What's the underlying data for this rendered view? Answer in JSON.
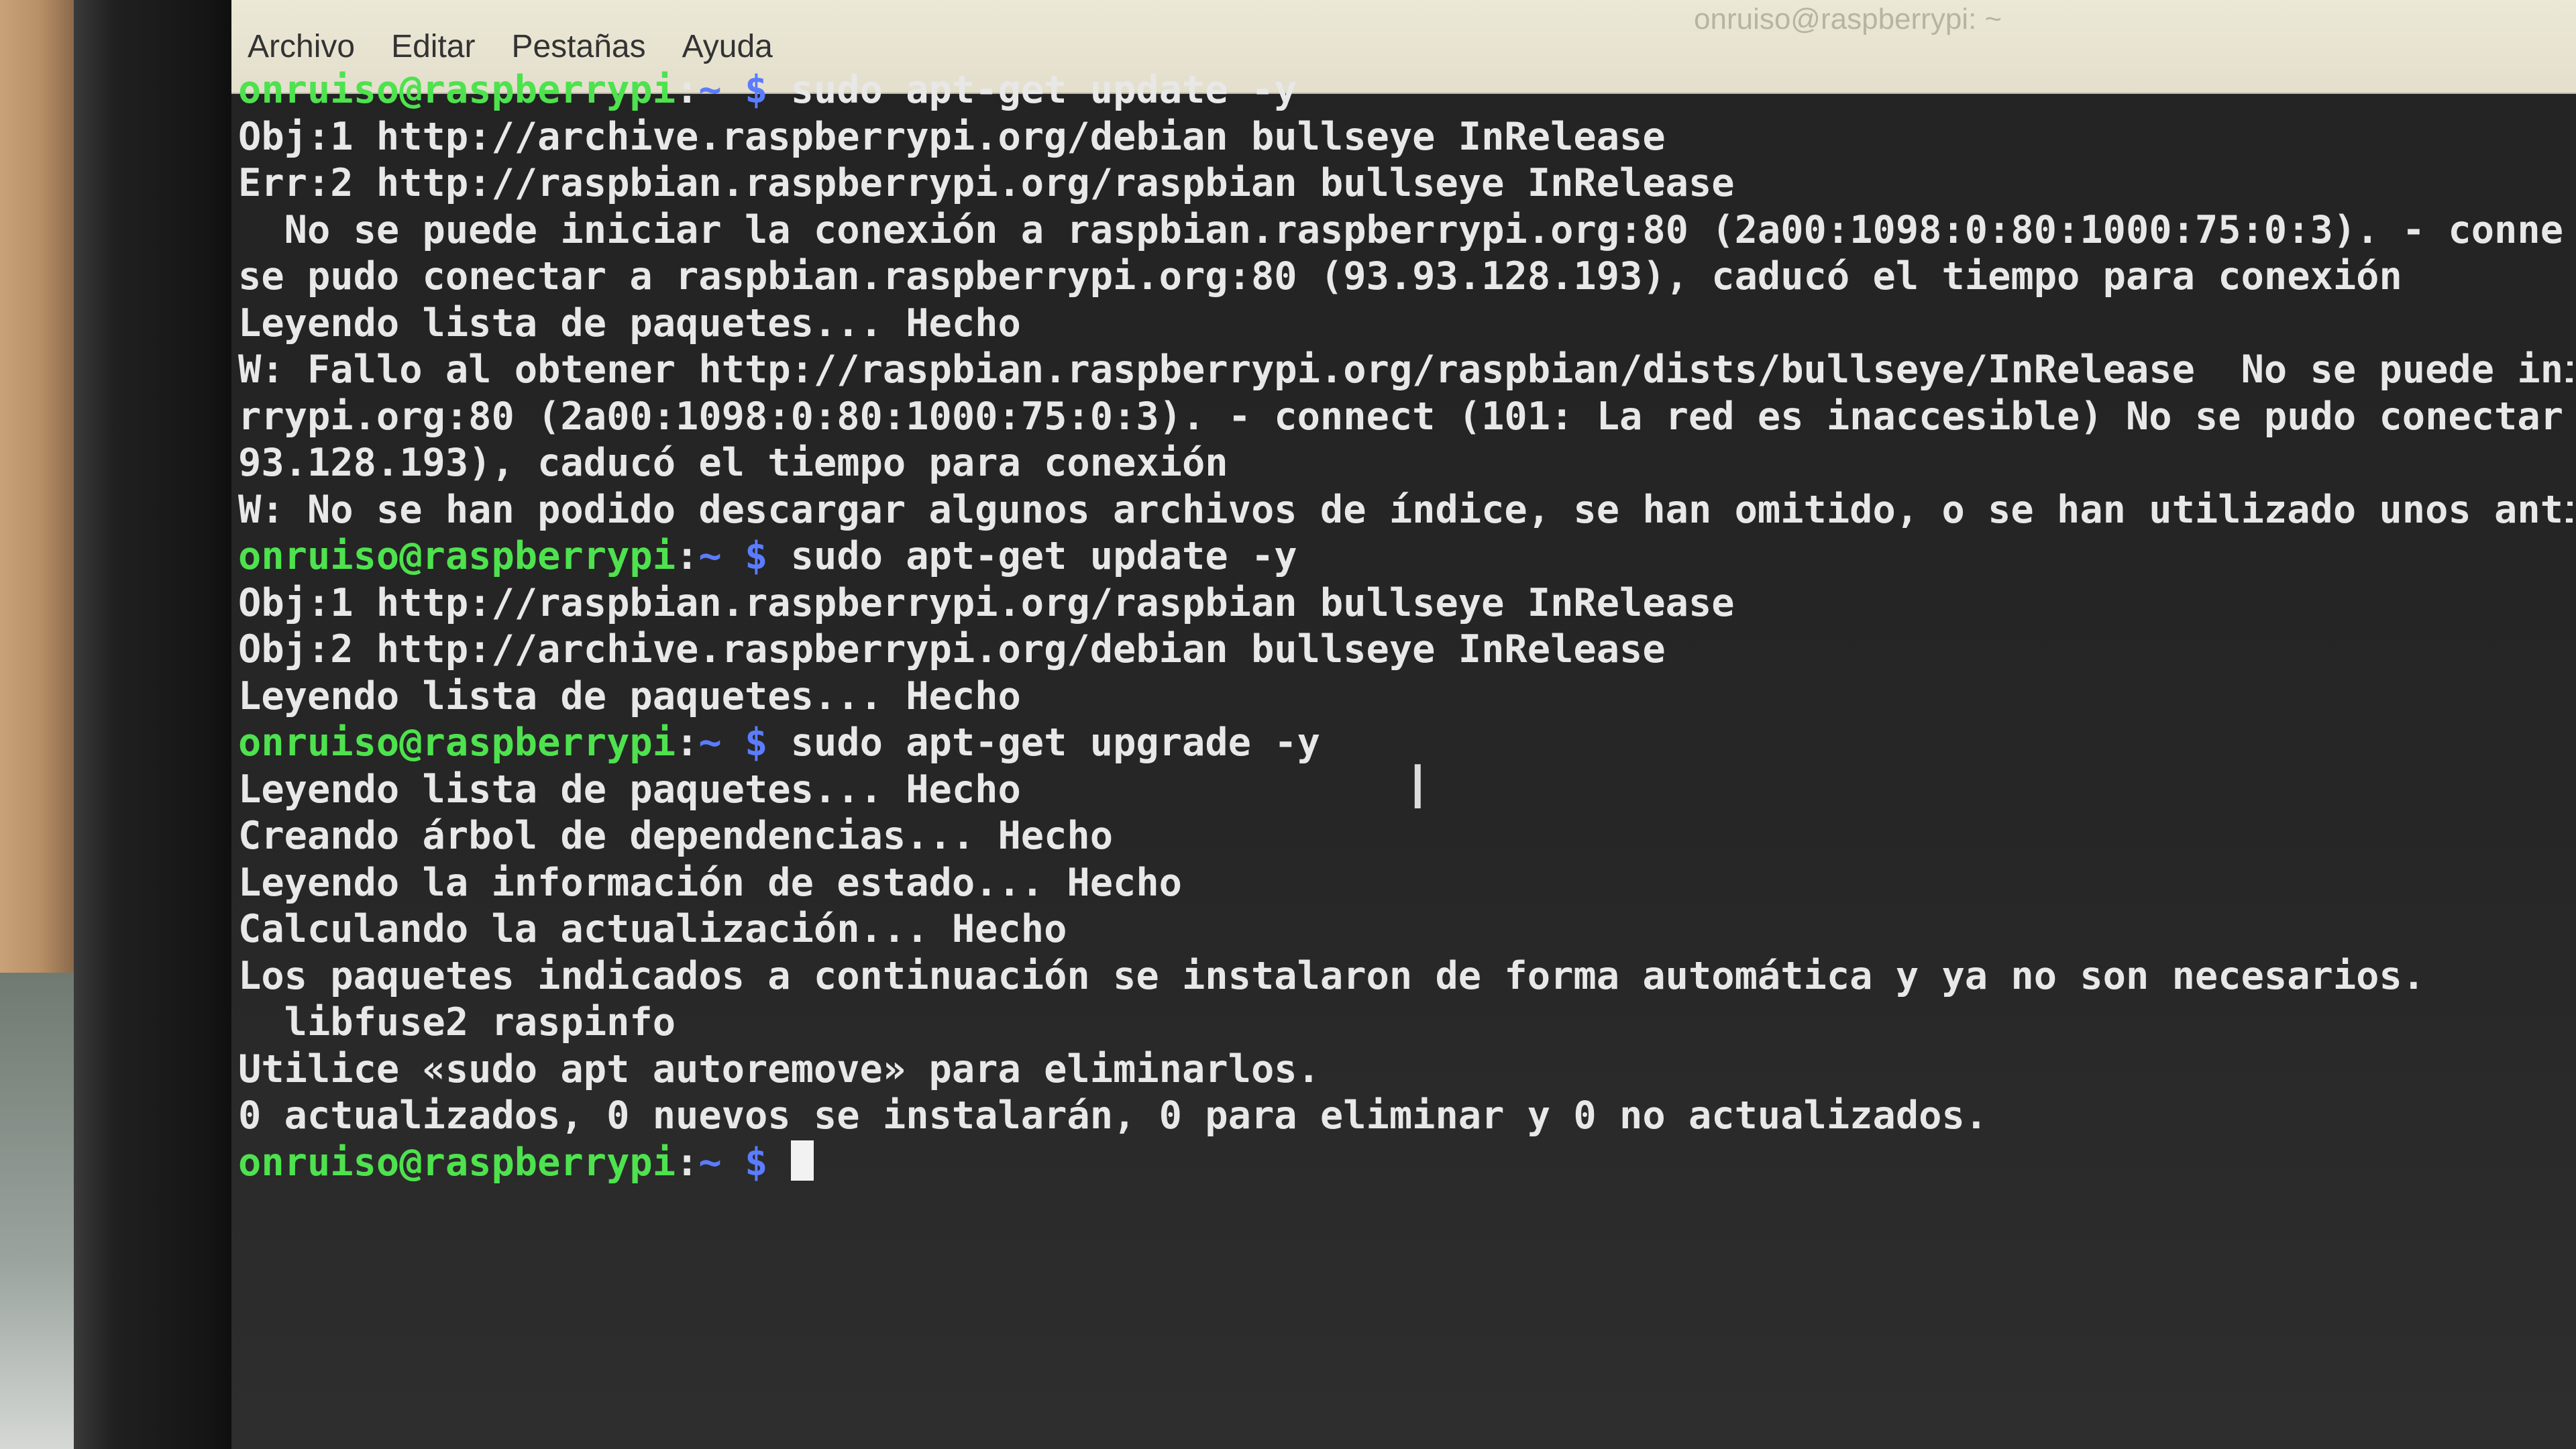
{
  "window": {
    "title": "onruiso@raspberrypi: ~"
  },
  "menu": [
    "Archivo",
    "Editar",
    "Pestañas",
    "Ayuda"
  ],
  "terminal": {
    "lines": [
      {
        "type": "prompt",
        "user": "onruiso@raspberrypi",
        "sep": ":",
        "path": "~ $",
        "cmd": " sudo apt-get update -y"
      },
      {
        "type": "out",
        "text": "Obj:1 http://archive.raspberrypi.org/debian bullseye InRelease"
      },
      {
        "type": "out",
        "text": "Err:2 http://raspbian.raspberrypi.org/raspbian bullseye InRelease"
      },
      {
        "type": "out",
        "text": "  No se puede iniciar la conexión a raspbian.raspberrypi.org:80 (2a00:1098:0:80:1000:75:0:3). - conne"
      },
      {
        "type": "out",
        "text": "se pudo conectar a raspbian.raspberrypi.org:80 (93.93.128.193), caducó el tiempo para conexión"
      },
      {
        "type": "out",
        "text": "Leyendo lista de paquetes... Hecho"
      },
      {
        "type": "out",
        "text": "W: Fallo al obtener http://raspbian.raspberrypi.org/raspbian/dists/bullseye/InRelease  No se puede ini"
      },
      {
        "type": "out",
        "text": "rrypi.org:80 (2a00:1098:0:80:1000:75:0:3). - connect (101: La red es inaccesible) No se pudo conectar"
      },
      {
        "type": "out",
        "text": "93.128.193), caducó el tiempo para conexión"
      },
      {
        "type": "out",
        "text": "W: No se han podido descargar algunos archivos de índice, se han omitido, o se han utilizado unos anti"
      },
      {
        "type": "prompt",
        "user": "onruiso@raspberrypi",
        "sep": ":",
        "path": "~ $",
        "cmd": " sudo apt-get update -y"
      },
      {
        "type": "out",
        "text": "Obj:1 http://raspbian.raspberrypi.org/raspbian bullseye InRelease"
      },
      {
        "type": "out",
        "text": "Obj:2 http://archive.raspberrypi.org/debian bullseye InRelease"
      },
      {
        "type": "out",
        "text": "Leyendo lista de paquetes... Hecho"
      },
      {
        "type": "prompt",
        "user": "onruiso@raspberrypi",
        "sep": ":",
        "path": "~ $",
        "cmd": " sudo apt-get upgrade -y"
      },
      {
        "type": "out",
        "text": "Leyendo lista de paquetes... Hecho"
      },
      {
        "type": "out",
        "text": "Creando árbol de dependencias... Hecho"
      },
      {
        "type": "out",
        "text": "Leyendo la información de estado... Hecho"
      },
      {
        "type": "out",
        "text": "Calculando la actualización... Hecho"
      },
      {
        "type": "out",
        "text": "Los paquetes indicados a continuación se instalaron de forma automática y ya no son necesarios."
      },
      {
        "type": "out",
        "text": "  libfuse2 raspinfo"
      },
      {
        "type": "out",
        "text": "Utilice «sudo apt autoremove» para eliminarlos."
      },
      {
        "type": "out",
        "text": "0 actualizados, 0 nuevos se instalarán, 0 para eliminar y 0 no actualizados."
      },
      {
        "type": "prompt",
        "user": "onruiso@raspberrypi",
        "sep": ":",
        "path": "~ $",
        "cmd": " ",
        "cursor": true
      }
    ]
  },
  "colors": {
    "prompt_user": "#4ee24e",
    "prompt_path": "#5b7cff",
    "text": "#e8e8e8",
    "background": "#252525",
    "menubar": "#e9e5d2"
  }
}
